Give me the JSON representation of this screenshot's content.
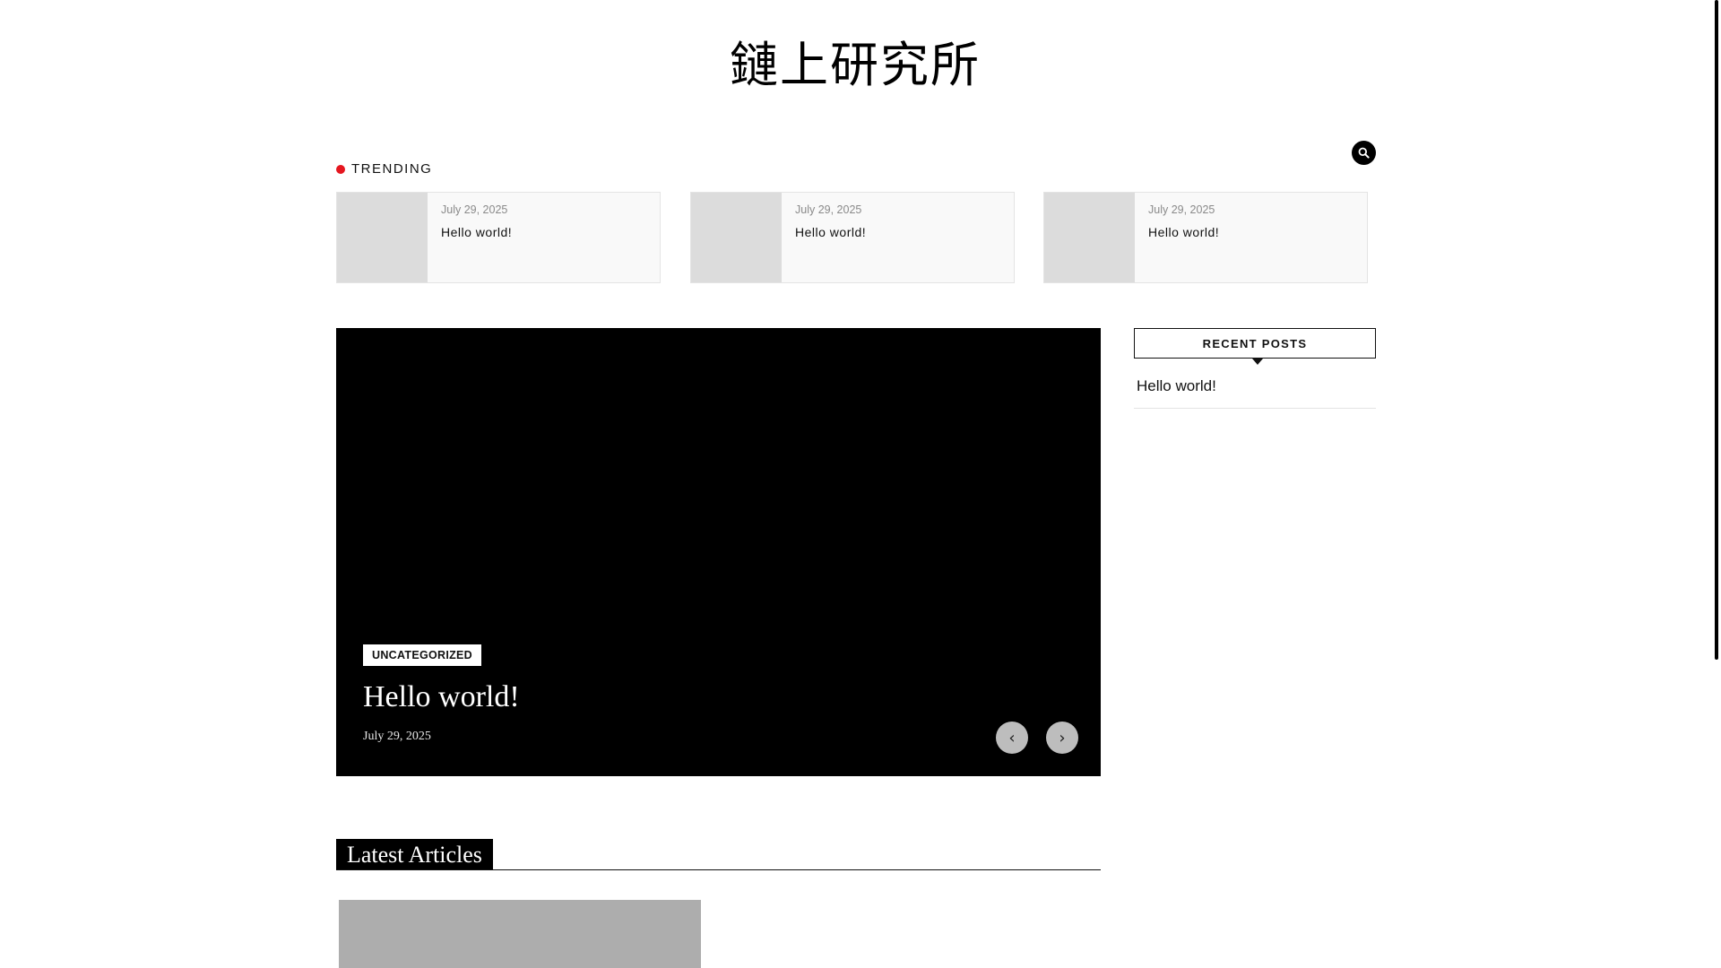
{
  "site": {
    "title": "鏈上研究所"
  },
  "header": {
    "search_icon": "search-icon"
  },
  "trending": {
    "label": "TRENDING",
    "accent": "#e5161f",
    "items": [
      {
        "date": "July 29, 2025",
        "title": "Hello world!"
      },
      {
        "date": "July 29, 2025",
        "title": "Hello world!"
      },
      {
        "date": "July 29, 2025",
        "title": "Hello world!"
      }
    ]
  },
  "slider": {
    "category": "UNCATEGORIZED",
    "title": "Hello world!",
    "date": "July 29, 2025",
    "prev_label": "‹",
    "next_label": "›"
  },
  "sidebar": {
    "recent_posts_label": "RECENT POSTS",
    "recent_posts": [
      {
        "title": "Hello world!"
      }
    ]
  },
  "latest": {
    "label": "Latest Articles"
  }
}
